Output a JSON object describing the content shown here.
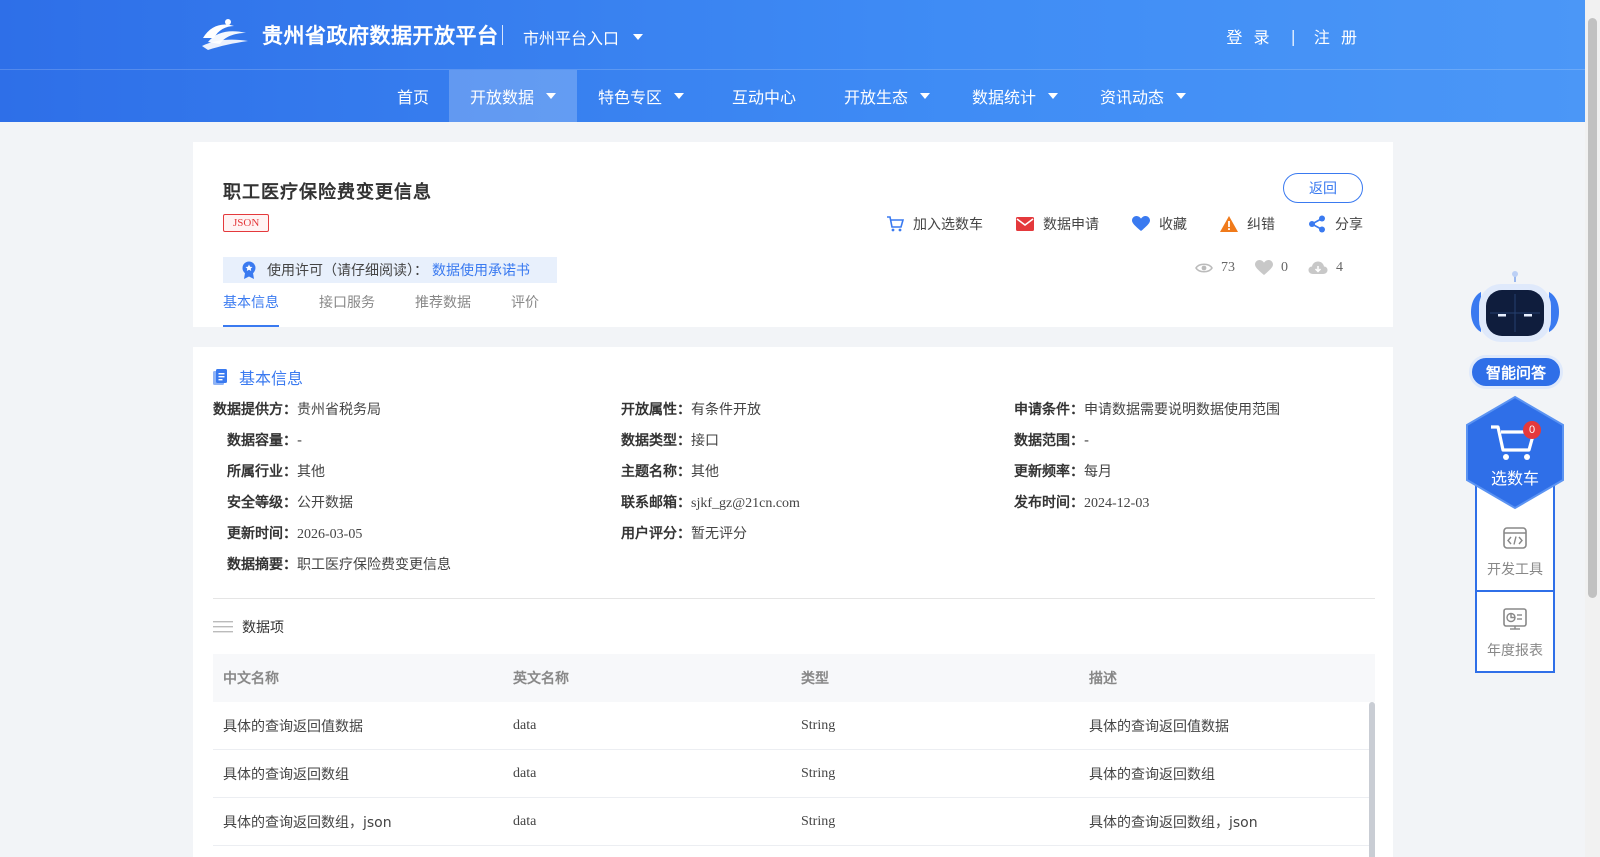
{
  "header": {
    "site_title": "贵州省政府数据开放平台",
    "city_entry": "市州平台入口",
    "login": "登 录",
    "register": "注 册",
    "auth_sep": "|"
  },
  "nav": {
    "items": [
      {
        "label": "首页",
        "dropdown": false,
        "active": false
      },
      {
        "label": "开放数据",
        "dropdown": true,
        "active": true
      },
      {
        "label": "特色专区",
        "dropdown": true,
        "active": false
      },
      {
        "label": "互动中心",
        "dropdown": false,
        "active": false
      },
      {
        "label": "开放生态",
        "dropdown": true,
        "active": false
      },
      {
        "label": "数据统计",
        "dropdown": true,
        "active": false
      },
      {
        "label": "资讯动态",
        "dropdown": true,
        "active": false
      }
    ]
  },
  "dataset": {
    "title": "职工医疗保险费变更信息",
    "format": "JSON",
    "back": "返回",
    "actions": {
      "add_cart": "加入选数车",
      "apply": "数据申请",
      "favorite": "收藏",
      "report": "纠错",
      "share": "分享"
    },
    "license": {
      "label": "使用许可（请仔细阅读）：",
      "link": "数据使用承诺书"
    },
    "stats": {
      "views": "73",
      "likes": "0",
      "downloads": "4"
    },
    "tabs": [
      "基本信息",
      "接口服务",
      "推荐数据",
      "评价"
    ]
  },
  "basic_info": {
    "section_title": "基本信息",
    "rows": [
      [
        {
          "label": "数据提供方：",
          "value": "贵州省税务局"
        },
        {
          "label": "开放属性：",
          "value": "有条件开放"
        },
        {
          "label": "申请条件：",
          "value": "申请数据需要说明数据使用范围"
        }
      ],
      [
        {
          "label": "数据容量：",
          "value": "-"
        },
        {
          "label": "数据类型：",
          "value": "接口"
        },
        {
          "label": "数据范围：",
          "value": "-"
        }
      ],
      [
        {
          "label": "所属行业：",
          "value": "其他"
        },
        {
          "label": "主题名称：",
          "value": "其他"
        },
        {
          "label": "更新频率：",
          "value": "每月"
        }
      ],
      [
        {
          "label": "安全等级：",
          "value": "公开数据"
        },
        {
          "label": "联系邮箱：",
          "value": "sjkf_gz@21cn.com"
        },
        {
          "label": "发布时间：",
          "value": "2024-12-03"
        }
      ],
      [
        {
          "label": "更新时间：",
          "value": "2026-03-05"
        },
        {
          "label": "用户评分：",
          "value": "暂无评分"
        }
      ],
      [
        {
          "label": "数据摘要：",
          "value": "职工医疗保险费变更信息"
        }
      ]
    ]
  },
  "data_items": {
    "title": "数据项",
    "headers": [
      "中文名称",
      "英文名称",
      "类型",
      "描述"
    ],
    "rows": [
      [
        "具体的查询返回值数据",
        "data",
        "String",
        "具体的查询返回值数据"
      ],
      [
        "具体的查询返回数组",
        "data",
        "String",
        "具体的查询返回数组"
      ],
      [
        "具体的查询返回数组，json",
        "data",
        "String",
        "具体的查询返回数组，json"
      ]
    ]
  },
  "widgets": {
    "qa": "智能问答",
    "cart": "选数车",
    "cart_count": "0",
    "dev_tools": "开发工具",
    "annual_report": "年度报表"
  },
  "colors": {
    "primary": "#3a7af0",
    "header_start": "#2e6fe8",
    "header_end": "#4b97f7",
    "danger": "#e4393c",
    "warning": "#f07a1a"
  }
}
